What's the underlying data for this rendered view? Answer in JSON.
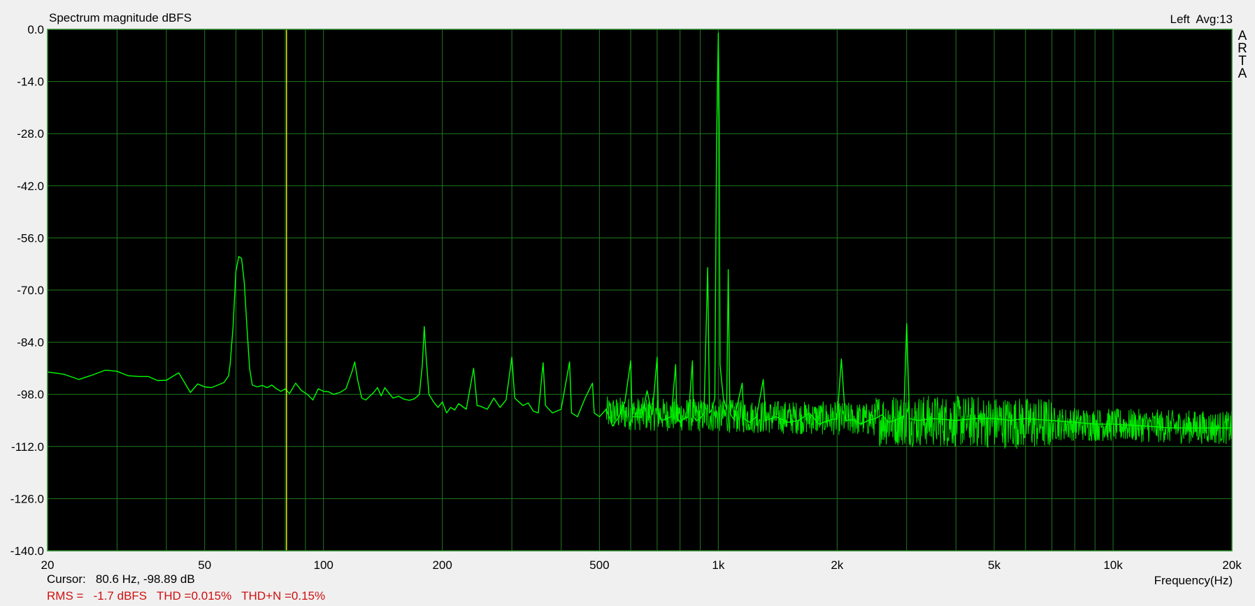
{
  "window": {
    "title": "Spectrum magnitude dBFS",
    "channel_info": "Left  Avg:13",
    "brand_letters": [
      "A",
      "R",
      "T",
      "A"
    ]
  },
  "cursor": {
    "label": "Cursor:",
    "readout": "80.6 Hz, -98.89 dB",
    "frequency_hz": 80.6
  },
  "measurements": {
    "text": "RMS =   -1.7 dBFS   THD =0.015%   THD+N =0.15%"
  },
  "colors": {
    "plot_bg": "#000000",
    "grid": "#1f7a1f",
    "trace": "#00ff00",
    "cursor": "#ffff00",
    "measurement_text": "#d01010"
  },
  "chart_data": {
    "type": "line",
    "title": "Spectrum magnitude dBFS",
    "xlabel": "Frequency(Hz)",
    "ylabel": "",
    "x_scale": "log",
    "xlim": [
      20,
      20000
    ],
    "ylim": [
      -140,
      0
    ],
    "grid": true,
    "x_ticks": [
      {
        "v": 20,
        "label": "20"
      },
      {
        "v": 50,
        "label": "50"
      },
      {
        "v": 100,
        "label": "100"
      },
      {
        "v": 200,
        "label": "200"
      },
      {
        "v": 500,
        "label": "500"
      },
      {
        "v": 1000,
        "label": "1k"
      },
      {
        "v": 2000,
        "label": "2k"
      },
      {
        "v": 5000,
        "label": "5k"
      },
      {
        "v": 10000,
        "label": "10k"
      },
      {
        "v": 20000,
        "label": "20k"
      }
    ],
    "y_ticks": [
      {
        "v": 0,
        "label": "0.0"
      },
      {
        "v": -14,
        "label": "-14.0"
      },
      {
        "v": -28,
        "label": "-28.0"
      },
      {
        "v": -42,
        "label": "-42.0"
      },
      {
        "v": -56,
        "label": "-56.0"
      },
      {
        "v": -70,
        "label": "-70.0"
      },
      {
        "v": -84,
        "label": "-84.0"
      },
      {
        "v": -98,
        "label": "-98.0"
      },
      {
        "v": -112,
        "label": "-112.0"
      },
      {
        "v": -126,
        "label": "-126.0"
      },
      {
        "v": -140,
        "label": "-140.0"
      }
    ],
    "series": [
      {
        "points": [
          [
            20,
            -92
          ],
          [
            22,
            -92.6
          ],
          [
            24,
            -94
          ],
          [
            26,
            -92.8
          ],
          [
            28,
            -91.5
          ],
          [
            30,
            -91.8
          ],
          [
            32,
            -93
          ],
          [
            34,
            -93.2
          ],
          [
            36,
            -93.2
          ],
          [
            38,
            -94.3
          ],
          [
            40,
            -94.2
          ],
          [
            43,
            -92.2
          ],
          [
            46,
            -97.5
          ],
          [
            48,
            -95.2
          ],
          [
            50,
            -96
          ],
          [
            52,
            -96.2
          ],
          [
            54,
            -95.5
          ],
          [
            56,
            -94.8
          ],
          [
            57.5,
            -93
          ],
          [
            58,
            -90
          ],
          [
            59,
            -80
          ],
          [
            60,
            -65
          ],
          [
            61,
            -61
          ],
          [
            62,
            -61.5
          ],
          [
            63,
            -68
          ],
          [
            64,
            -80
          ],
          [
            65,
            -91
          ],
          [
            66,
            -95.5
          ],
          [
            68,
            -96
          ],
          [
            70,
            -95.6
          ],
          [
            72,
            -96.2
          ],
          [
            74,
            -95.5
          ],
          [
            76,
            -96.5
          ],
          [
            78,
            -97.2
          ],
          [
            80,
            -96.5
          ],
          [
            82,
            -97.8
          ],
          [
            85,
            -95
          ],
          [
            88,
            -97
          ],
          [
            91,
            -98
          ],
          [
            94,
            -99.5
          ],
          [
            97,
            -96.5
          ],
          [
            100,
            -97.2
          ],
          [
            103,
            -97.3
          ],
          [
            106,
            -98
          ],
          [
            110,
            -97.5
          ],
          [
            114,
            -96.5
          ],
          [
            118,
            -92
          ],
          [
            120,
            -89.3
          ],
          [
            122,
            -94
          ],
          [
            125,
            -99
          ],
          [
            128,
            -99.5
          ],
          [
            131,
            -98.5
          ],
          [
            134,
            -97.5
          ],
          [
            137,
            -96.2
          ],
          [
            140,
            -98.4
          ],
          [
            143,
            -96.2
          ],
          [
            146,
            -97.5
          ],
          [
            150,
            -99
          ],
          [
            155,
            -98.5
          ],
          [
            160,
            -99.3
          ],
          [
            165,
            -99.6
          ],
          [
            170,
            -99.2
          ],
          [
            175,
            -98
          ],
          [
            178,
            -90
          ],
          [
            180,
            -79.8
          ],
          [
            182,
            -88
          ],
          [
            185,
            -98
          ],
          [
            190,
            -100
          ],
          [
            195,
            -101.5
          ],
          [
            200,
            -100
          ],
          [
            205,
            -103
          ],
          [
            210,
            -101.5
          ],
          [
            215,
            -102.2
          ],
          [
            220,
            -100.5
          ],
          [
            230,
            -102
          ],
          [
            240,
            -91
          ],
          [
            245,
            -101
          ],
          [
            250,
            -101.2
          ],
          [
            260,
            -102
          ],
          [
            270,
            -99
          ],
          [
            280,
            -101.5
          ],
          [
            290,
            -99.5
          ],
          [
            300,
            -88
          ],
          [
            305,
            -99
          ],
          [
            320,
            -101
          ],
          [
            330,
            -100.3
          ],
          [
            340,
            -102.5
          ],
          [
            350,
            -103
          ],
          [
            360,
            -89.5
          ],
          [
            365,
            -101
          ],
          [
            380,
            -103
          ],
          [
            400,
            -102
          ],
          [
            420,
            -89.3
          ],
          [
            425,
            -103
          ],
          [
            440,
            -104
          ],
          [
            460,
            -99
          ],
          [
            480,
            -95
          ],
          [
            485,
            -103
          ],
          [
            500,
            -104
          ],
          [
            520,
            -102
          ],
          [
            540,
            -106.5
          ],
          [
            560,
            -104
          ],
          [
            580,
            -100
          ],
          [
            600,
            -89
          ],
          [
            605,
            -104
          ],
          [
            620,
            -104
          ],
          [
            640,
            -104.2
          ],
          [
            660,
            -97
          ],
          [
            680,
            -103.5
          ],
          [
            700,
            -88
          ],
          [
            705,
            -103
          ],
          [
            720,
            -105
          ],
          [
            740,
            -104.5
          ],
          [
            760,
            -104
          ],
          [
            780,
            -90
          ],
          [
            785,
            -104
          ],
          [
            800,
            -105.5
          ],
          [
            820,
            -104.5
          ],
          [
            840,
            -104
          ],
          [
            860,
            -89
          ],
          [
            865,
            -104
          ],
          [
            880,
            -105
          ],
          [
            900,
            -104.5
          ],
          [
            920,
            -103
          ],
          [
            940,
            -64
          ],
          [
            950,
            -103
          ],
          [
            965,
            -102
          ],
          [
            980,
            -99
          ],
          [
            990,
            -30
          ],
          [
            1000,
            -1
          ],
          [
            1005,
            -25
          ],
          [
            1010,
            -90
          ],
          [
            1030,
            -99
          ],
          [
            1050,
            -102
          ],
          [
            1060,
            -64.5
          ],
          [
            1070,
            -103
          ],
          [
            1090,
            -104.5
          ],
          [
            1100,
            -104
          ],
          [
            1150,
            -95
          ],
          [
            1160,
            -104.5
          ],
          [
            1200,
            -105.5
          ],
          [
            1250,
            -104
          ],
          [
            1300,
            -94
          ],
          [
            1320,
            -105
          ],
          [
            1400,
            -104
          ],
          [
            1500,
            -105.5
          ],
          [
            1600,
            -105
          ],
          [
            1700,
            -103
          ],
          [
            1800,
            -106
          ],
          [
            1900,
            -105
          ],
          [
            2000,
            -104.5
          ],
          [
            2050,
            -88.5
          ],
          [
            2100,
            -105
          ],
          [
            2200,
            -104.8
          ],
          [
            2300,
            -106
          ],
          [
            2400,
            -105
          ],
          [
            2500,
            -104.5
          ],
          [
            2600,
            -103.5
          ],
          [
            2700,
            -105.5
          ],
          [
            2800,
            -105
          ],
          [
            2950,
            -104
          ],
          [
            3000,
            -79
          ],
          [
            3050,
            -104.5
          ],
          [
            3200,
            -105
          ],
          [
            3500,
            -104.5
          ],
          [
            4000,
            -105
          ],
          [
            4500,
            -104.5
          ],
          [
            5000,
            -104.5
          ],
          [
            5500,
            -105
          ],
          [
            6000,
            -104.5
          ],
          [
            6500,
            -104.8
          ],
          [
            7000,
            -105
          ],
          [
            8000,
            -105.5
          ],
          [
            9000,
            -106
          ],
          [
            10000,
            -106
          ],
          [
            12000,
            -106.5
          ],
          [
            14000,
            -107
          ],
          [
            16000,
            -107
          ],
          [
            18000,
            -107
          ],
          [
            20000,
            -107
          ]
        ]
      }
    ]
  }
}
